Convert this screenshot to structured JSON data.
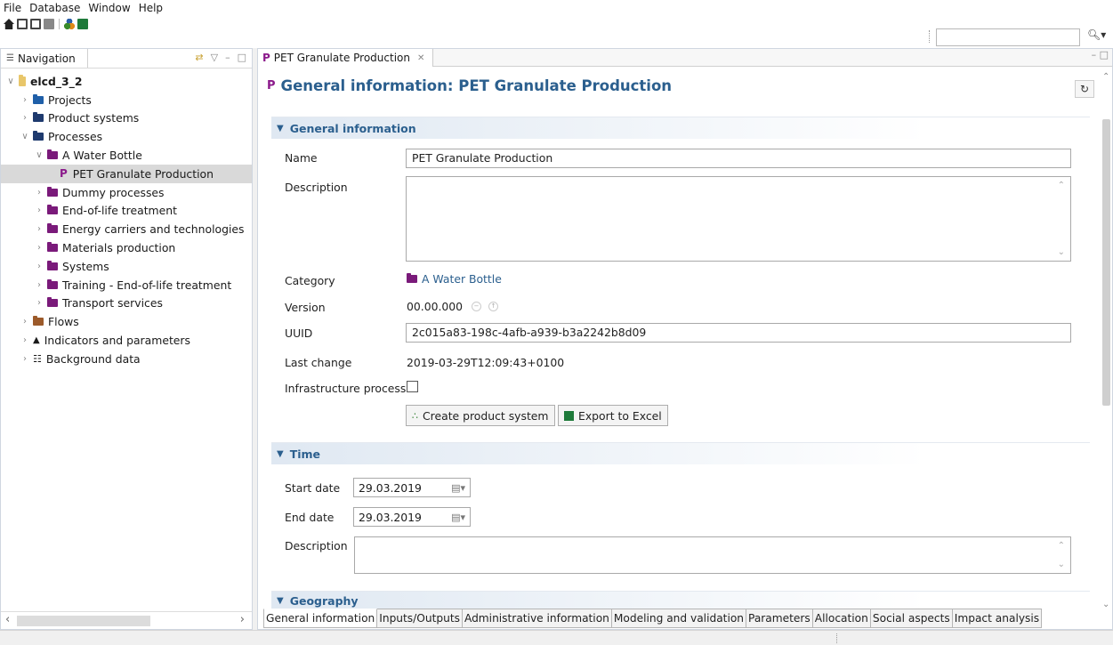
{
  "menu": [
    "File",
    "Database",
    "Window",
    "Help"
  ],
  "toolbar": {
    "search_value": ""
  },
  "navigation": {
    "title": "Navigation",
    "tree": [
      {
        "label": "elcd_3_2",
        "level": 0,
        "expanded": true,
        "bold": true,
        "icon": "database-icon"
      },
      {
        "label": "Projects",
        "level": 1,
        "expanded": false,
        "icon": "folder-blue"
      },
      {
        "label": "Product systems",
        "level": 1,
        "expanded": false,
        "icon": "folder-navy"
      },
      {
        "label": "Processes",
        "level": 1,
        "expanded": true,
        "icon": "folder-navy"
      },
      {
        "label": "A Water Bottle",
        "level": 2,
        "expanded": true,
        "icon": "folder-purple"
      },
      {
        "label": "PET Granulate Production",
        "level": 3,
        "selected": true,
        "icon": "process-p"
      },
      {
        "label": "Dummy processes",
        "level": 2,
        "expanded": false,
        "icon": "folder-purple"
      },
      {
        "label": "End-of-life treatment",
        "level": 2,
        "expanded": false,
        "icon": "folder-purple"
      },
      {
        "label": "Energy carriers and technologies",
        "level": 2,
        "expanded": false,
        "icon": "folder-purple"
      },
      {
        "label": "Materials production",
        "level": 2,
        "expanded": false,
        "icon": "folder-purple"
      },
      {
        "label": "Systems",
        "level": 2,
        "expanded": false,
        "icon": "folder-purple"
      },
      {
        "label": "Training - End-of-life treatment",
        "level": 2,
        "expanded": false,
        "icon": "folder-purple"
      },
      {
        "label": "Transport services",
        "level": 2,
        "expanded": false,
        "icon": "folder-purple"
      },
      {
        "label": "Flows",
        "level": 1,
        "expanded": false,
        "icon": "folder-brown"
      },
      {
        "label": "Indicators and parameters",
        "level": 1,
        "expanded": false,
        "icon": "indicator-icon"
      },
      {
        "label": "Background data",
        "level": 1,
        "expanded": false,
        "icon": "grid-icon"
      }
    ]
  },
  "editor": {
    "tab_label": "PET Granulate Production",
    "heading": "General information: PET Granulate Production",
    "general": {
      "section_title": "General information",
      "name_label": "Name",
      "name_value": "PET Granulate Production",
      "description_label": "Description",
      "description_value": "",
      "category_label": "Category",
      "category_value": "A Water Bottle",
      "version_label": "Version",
      "version_value": "00.00.000",
      "uuid_label": "UUID",
      "uuid_value": "2c015a83-198c-4afb-a939-b3a2242b8d09",
      "last_change_label": "Last change",
      "last_change_value": "2019-03-29T12:09:43+0100",
      "infrastructure_label": "Infrastructure process",
      "infrastructure_checked": false,
      "create_button": "Create product system",
      "export_button": "Export to Excel"
    },
    "time": {
      "section_title": "Time",
      "start_label": "Start date",
      "start_value": "29.03.2019",
      "end_label": "End date",
      "end_value": "29.03.2019",
      "description_label": "Description",
      "description_value": ""
    },
    "geography": {
      "section_title": "Geography"
    },
    "bottom_tabs": [
      "General information",
      "Inputs/Outputs",
      "Administrative information",
      "Modeling and validation",
      "Parameters",
      "Allocation",
      "Social aspects",
      "Impact analysis"
    ]
  },
  "colors": {
    "accent": "#2b5f8e",
    "process_purple": "#8b1a8b",
    "folder_blue": "#1f5fa8",
    "folder_navy": "#1e3a6e",
    "folder_purple": "#7a1a7a",
    "folder_brown": "#9c5a2a",
    "database_yellow": "#e8c66a"
  }
}
